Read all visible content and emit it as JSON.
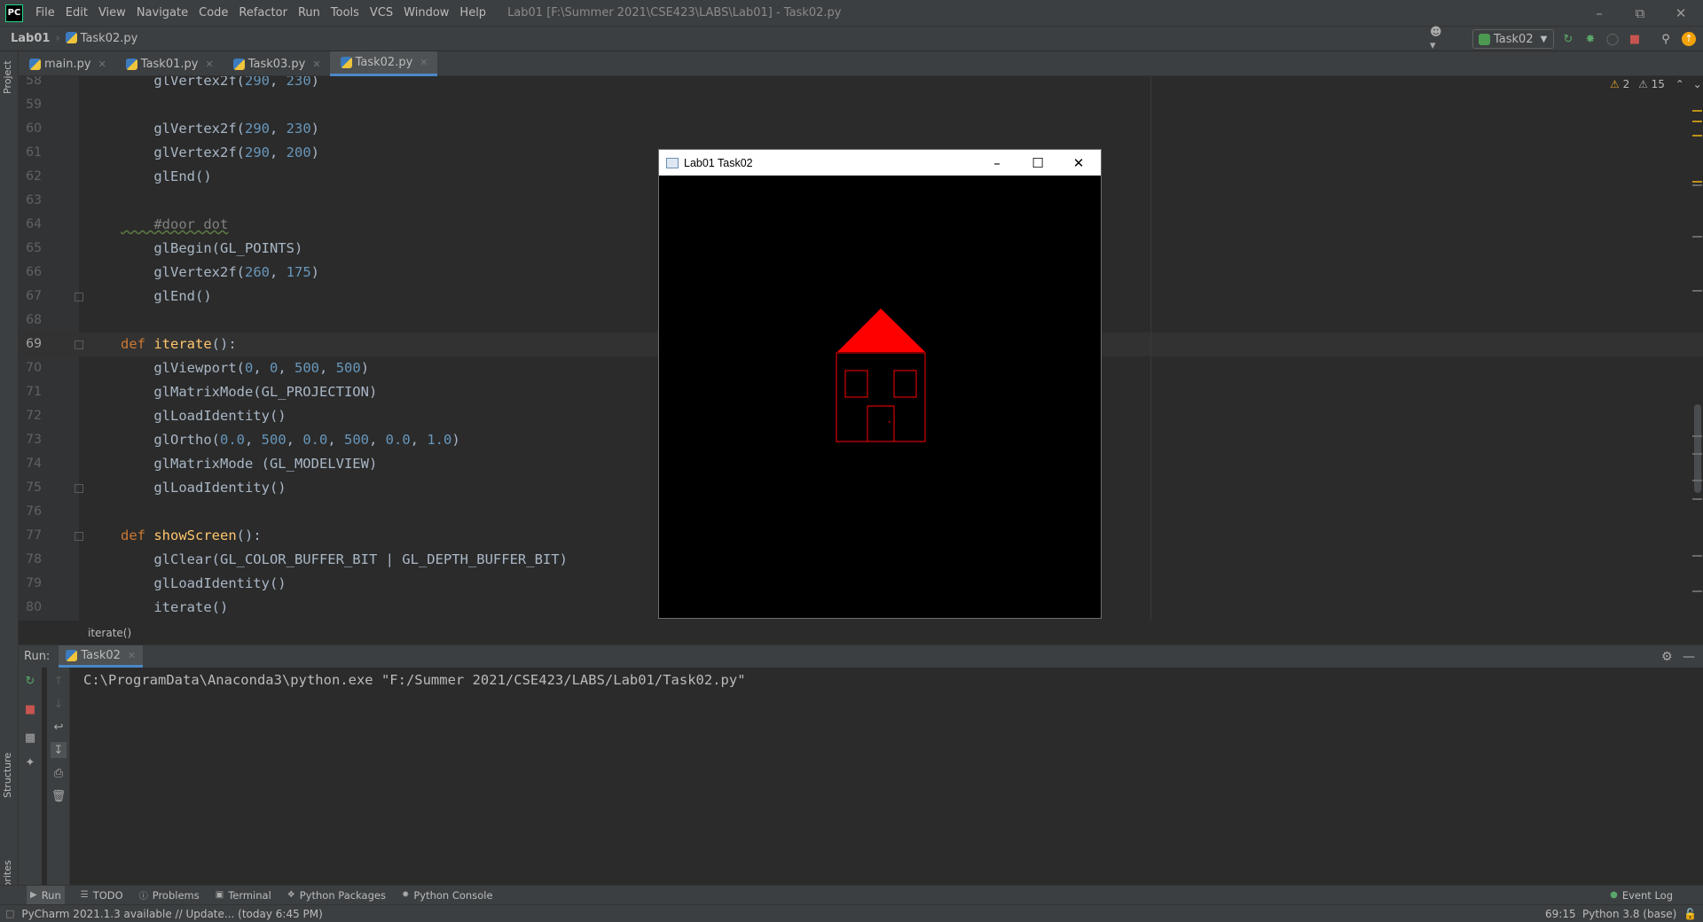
{
  "menubar": {
    "items": [
      "File",
      "Edit",
      "View",
      "Navigate",
      "Code",
      "Refactor",
      "Run",
      "Tools",
      "VCS",
      "Window",
      "Help"
    ],
    "window_title": "Lab01 [F:\\Summer 2021\\CSE423\\LABS\\Lab01] - Task02.py"
  },
  "navbar": {
    "project": "Lab01",
    "file": "Task02.py",
    "run_config": "Task02"
  },
  "left_strip": {
    "project_label": "Project",
    "structure_label": "Structure",
    "favorites_label": "Favorites"
  },
  "tabs": [
    {
      "label": "main.py"
    },
    {
      "label": "Task01.py"
    },
    {
      "label": "Task03.py"
    },
    {
      "label": "Task02.py"
    }
  ],
  "inspections": {
    "warnings": "2",
    "weak_warnings": "15"
  },
  "lines": [
    {
      "n": "58",
      "t": "    glVertex2f(290, 230)"
    },
    {
      "n": "59",
      "t": ""
    },
    {
      "n": "60",
      "t": "    glVertex2f(290, 230)"
    },
    {
      "n": "61",
      "t": "    glVertex2f(290, 200)"
    },
    {
      "n": "62",
      "t": "    glEnd()"
    },
    {
      "n": "63",
      "t": ""
    },
    {
      "n": "64",
      "t": "    #door dot"
    },
    {
      "n": "65",
      "t": "    glBegin(GL_POINTS)"
    },
    {
      "n": "66",
      "t": "    glVertex2f(260, 175)"
    },
    {
      "n": "67",
      "t": "    glEnd()"
    },
    {
      "n": "68",
      "t": ""
    },
    {
      "n": "69",
      "t": "def iterate():"
    },
    {
      "n": "70",
      "t": "    glViewport(0, 0, 500, 500)"
    },
    {
      "n": "71",
      "t": "    glMatrixMode(GL_PROJECTION)"
    },
    {
      "n": "72",
      "t": "    glLoadIdentity()"
    },
    {
      "n": "73",
      "t": "    glOrtho(0.0, 500, 0.0, 500, 0.0, 1.0)"
    },
    {
      "n": "74",
      "t": "    glMatrixMode (GL_MODELVIEW)"
    },
    {
      "n": "75",
      "t": "    glLoadIdentity()"
    },
    {
      "n": "76",
      "t": ""
    },
    {
      "n": "77",
      "t": "def showScreen():"
    },
    {
      "n": "78",
      "t": "    glClear(GL_COLOR_BUFFER_BIT | GL_DEPTH_BUFFER_BIT)"
    },
    {
      "n": "79",
      "t": "    glLoadIdentity()"
    },
    {
      "n": "80",
      "t": "    iterate()"
    }
  ],
  "current_line": "69",
  "breadcrumb": "iterate()",
  "run_panel": {
    "label": "Run:",
    "tab": "Task02",
    "console": "C:\\ProgramData\\Anaconda3\\python.exe \"F:/Summer 2021/CSE423/LABS/Lab01/Task02.py\""
  },
  "bottom_tools": [
    "Run",
    "TODO",
    "Problems",
    "Terminal",
    "Python Packages",
    "Python Console"
  ],
  "event_log": "Event Log",
  "status": {
    "message": "PyCharm 2021.1.3 available // Update... (today 6:45 PM)",
    "position": "69:15",
    "interpreter": "Python 3.8 (base)"
  },
  "gl_window": {
    "title": "Lab01 Task02",
    "house_color": "#ff0000"
  },
  "colors": {
    "keyword": "#cc7832",
    "function": "#ffc66d",
    "number": "#6897bb",
    "comment": "#808080",
    "accent": "#4a88c7"
  }
}
